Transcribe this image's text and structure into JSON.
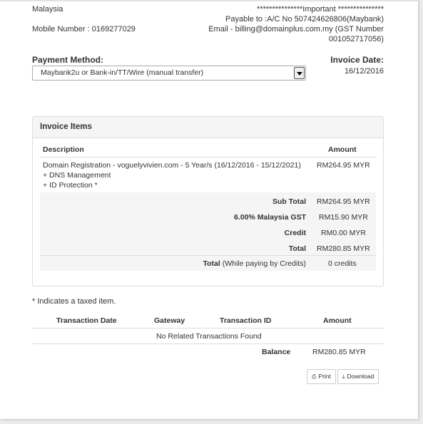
{
  "address": {
    "country": "Malaysia",
    "mobile": "Mobile Number : 0169277029"
  },
  "payment_info": {
    "line1": "***************Important ***************",
    "line2": "Payable to :A/C No 507424626806(Maybank)",
    "line3": "Email - billing@domainplus.com.my (GST Number",
    "line4": "001052717056)"
  },
  "payment_method": {
    "label": "Payment Method:",
    "selected": "Maybank2u or Bank-in/TT/Wire (manual transfer)"
  },
  "invoice_date": {
    "label": "Invoice Date:",
    "value": "16/12/2016"
  },
  "invoice_items": {
    "title": "Invoice Items",
    "header_description": "Description",
    "header_amount": "Amount",
    "item_lines": [
      "Domain Registration - voguelyvivien.com - 5 Year/s (16/12/2016 - 15/12/2021)",
      "+ DNS Management",
      "+ ID Protection *"
    ],
    "item_amount": "RM264.95 MYR",
    "subtotal_label": "Sub Total",
    "subtotal_value": "RM264.95 MYR",
    "gst_label": "6.00% Malaysia GST",
    "gst_value": "RM15.90 MYR",
    "credit_label": "Credit",
    "credit_value": "RM0.00 MYR",
    "total_label": "Total",
    "total_value": "RM280.85 MYR",
    "total_credits_label_bold": "Total",
    "total_credits_label_rest": " (While paying by Credits)",
    "total_credits_value": "0 credits"
  },
  "tax_note": "* Indicates a taxed item.",
  "transactions": {
    "headers": [
      "Transaction Date",
      "Gateway",
      "Transaction ID",
      "Amount"
    ],
    "empty_message": "No Related Transactions Found",
    "balance_label": "Balance",
    "balance_value": "RM280.85 MYR"
  },
  "buttons": {
    "print": "Print",
    "download": "Download"
  },
  "icons": {
    "print": "printer-icon",
    "download": "download-icon"
  }
}
